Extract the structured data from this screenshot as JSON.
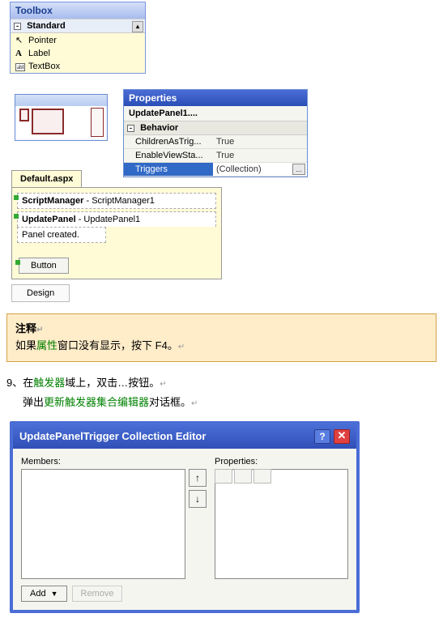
{
  "toolbox": {
    "title": "Toolbox",
    "category": "Standard",
    "items": [
      "Pointer",
      "Label",
      "TextBox"
    ]
  },
  "properties": {
    "title": "Properties",
    "object": "UpdatePanel1....",
    "category": "Behavior",
    "rows": [
      {
        "name": "ChildrenAsTrig...",
        "value": "True"
      },
      {
        "name": "EnableViewSta...",
        "value": "True"
      },
      {
        "name": "Triggers",
        "value": "(Collection)"
      }
    ]
  },
  "default_aspx": {
    "tab": "Default.aspx",
    "sm_label": "ScriptManager",
    "sm_id": " - ScriptManager1",
    "up_label": "UpdatePanel",
    "up_id": " - UpdatePanel1",
    "panel_created": "Panel created.",
    "button": "Button"
  },
  "design_tab": "Design",
  "note": {
    "hdr": "注释",
    "line_a": "如果",
    "line_b": "属性",
    "line_c": "窗口没有显示，按下 F4。"
  },
  "step9": {
    "prefix": "9、在",
    "trig": "触发器",
    "mid": "域上，双击…按钮。",
    "pop_prefix": "弹出",
    "editor_name": "更新触发器集合编辑器",
    "pop_suffix": "对话框。"
  },
  "editor": {
    "title": "UpdatePanelTrigger Collection Editor",
    "help": "?",
    "close": "✕",
    "members": "Members:",
    "properties": "Properties:",
    "up": "↑",
    "down": "↓",
    "add": "Add",
    "remove": "Remove"
  }
}
